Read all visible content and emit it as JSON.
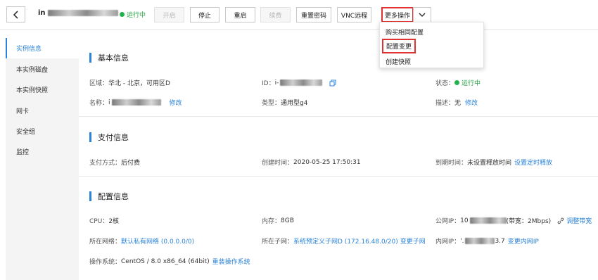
{
  "header": {
    "instance_name_prefix": "in",
    "status": "运行中",
    "buttons": {
      "start": "开启",
      "stop": "停止",
      "restart": "重启",
      "renew": "续费",
      "reset_password": "重置密码",
      "vnc": "VNC远程",
      "more_actions": "更多操作"
    }
  },
  "dropdown": {
    "items": [
      "购买相同配置",
      "配置变更",
      "创建快照"
    ]
  },
  "sidebar": {
    "items": [
      {
        "label": "实例信息",
        "active": true
      },
      {
        "label": "本实例磁盘",
        "active": false
      },
      {
        "label": "本实例快照",
        "active": false
      },
      {
        "label": "网卡",
        "active": false
      },
      {
        "label": "安全组",
        "active": false
      },
      {
        "label": "监控",
        "active": false
      }
    ]
  },
  "basic": {
    "title": "基本信息",
    "region_label": "区域：",
    "region_value": "华北 - 北京，可用区D",
    "id_label": "ID：",
    "id_prefix": "i-",
    "status_label": "状态：",
    "status_value": "运行中",
    "name_label": "名称：",
    "name_prefix": "i",
    "name_edit": "修改",
    "type_label": "类型：",
    "type_value": "通用型g4",
    "desc_label": "描述：",
    "desc_value": "无",
    "desc_edit": "修改"
  },
  "payment": {
    "title": "支付信息",
    "method_label": "支付方式：",
    "method_value": "后付费",
    "created_label": "创建时间：",
    "created_value": "2020-05-25 17:50:31",
    "expire_label": "到期时间：",
    "expire_value": "未设置释放时间",
    "expire_link": "设置定时释放"
  },
  "config": {
    "title": "配置信息",
    "cpu_label": "CPU：",
    "cpu_value": "2核",
    "mem_label": "内存：",
    "mem_value": "8GB",
    "public_ip_label": "公网IP：",
    "public_ip_prefix": "10",
    "bandwidth_text": "(带宽：2Mbps)",
    "adjust_bandwidth": "调整带宽",
    "network_label": "所在网络：",
    "network_value": "默认私有网络 (0.0.0.0/0)",
    "subnet_label": "所在子网：",
    "subnet_value": "系统预定义子网D (172.16.48.0/20)",
    "subnet_change": "变更子网",
    "private_ip_label": "内网IP：",
    "private_ip_prefix": "'.",
    "private_ip_suffix": "3.7",
    "private_ip_change": "变更内网IP",
    "os_label": "操作系统：",
    "os_value": "CentOS / 8.0 x86_64 (64bit)",
    "os_reinstall": "重装操作系统"
  },
  "colors": {
    "accent": "#2b83d8",
    "running": "#22b14c",
    "highlight_border": "#e03232"
  }
}
